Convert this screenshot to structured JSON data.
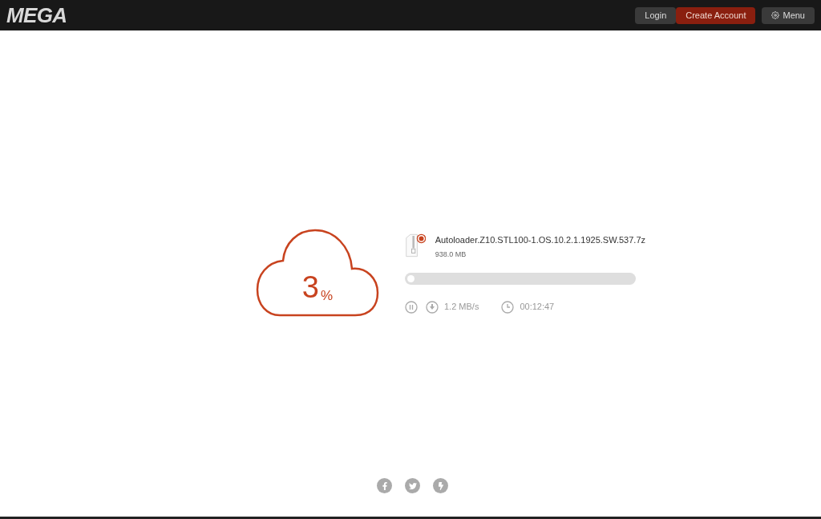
{
  "header": {
    "logo": "MEGA",
    "buttons": [
      {
        "label": "Login",
        "kind": "plain"
      },
      {
        "label": "Create Account",
        "kind": "primary"
      },
      {
        "label": "Menu",
        "kind": "menu"
      }
    ]
  },
  "download": {
    "percent": "3",
    "unit": "%",
    "file_name": "Autoloader.Z10.STL100-1.OS.10.2.1.1925.SW.537.7z",
    "file_size": "938.0 MB",
    "level": 0.03,
    "speed": "1.2 MB/s",
    "time_left": "00:12:47"
  }
}
